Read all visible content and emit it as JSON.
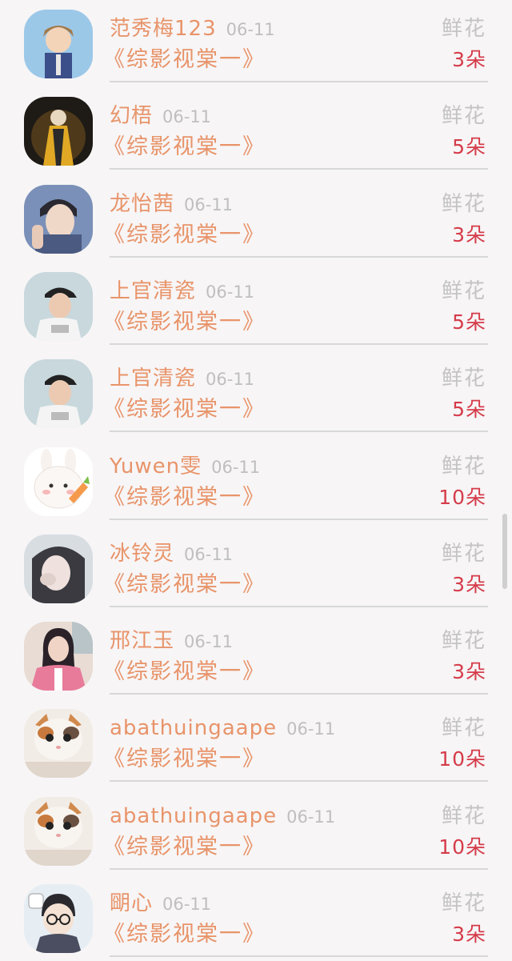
{
  "gift_label": "鲜花",
  "items": [
    {
      "name": "范秀梅123",
      "date": "06-11",
      "book": "《综影视棠一》",
      "count": "3朵",
      "avatar": "anime-boy-avatar"
    },
    {
      "name": "幻梧",
      "date": "06-11",
      "book": "《综影视棠一》",
      "count": "5朵",
      "avatar": "golden-warrior-avatar"
    },
    {
      "name": "龙怡茜",
      "date": "06-11",
      "book": "《综影视棠一》",
      "count": "3朵",
      "avatar": "young-man-avatar"
    },
    {
      "name": "上官清瓷",
      "date": "06-11",
      "book": "《综影视棠一》",
      "count": "5朵",
      "avatar": "man-in-cap-avatar"
    },
    {
      "name": "上官清瓷",
      "date": "06-11",
      "book": "《综影视棠一》",
      "count": "5朵",
      "avatar": "man-in-cap-avatar"
    },
    {
      "name": "Yuwen雯",
      "date": "06-11",
      "book": "《综影视棠一》",
      "count": "10朵",
      "avatar": "cartoon-rabbit-avatar"
    },
    {
      "name": "冰铃灵",
      "date": "06-11",
      "book": "《综影视棠一》",
      "count": "3朵",
      "avatar": "girl-selfie-avatar"
    },
    {
      "name": "邢江玉",
      "date": "06-11",
      "book": "《综影视棠一》",
      "count": "3朵",
      "avatar": "girl-pink-jacket-avatar"
    },
    {
      "name": "abathuingaape",
      "date": "06-11",
      "book": "《综影视棠一》",
      "count": "10朵",
      "avatar": "kitten-avatar"
    },
    {
      "name": "abathuingaape",
      "date": "06-11",
      "book": "《综影视棠一》",
      "count": "10朵",
      "avatar": "kitten-avatar"
    },
    {
      "name": "朙心",
      "date": "06-11",
      "book": "《综影视棠一》",
      "count": "3朵",
      "avatar": "cartoon-glasses-avatar"
    }
  ],
  "colors": {
    "name": "#e8946a",
    "date": "#bfbfbf",
    "count": "#d53c4a",
    "gift": "#c4c4c4",
    "background": "#f7f5f6"
  }
}
